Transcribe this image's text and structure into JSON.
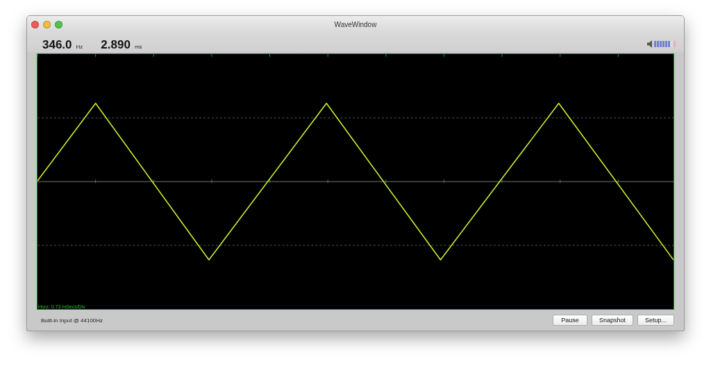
{
  "window": {
    "title": "WaveWindow"
  },
  "readouts": [
    {
      "value": "346.0",
      "unit": "Hz"
    },
    {
      "value": "2.890",
      "unit": "ms"
    }
  ],
  "volume": {
    "level": 0.75
  },
  "scope": {
    "scale_label": "Horz: 0.73 mSecs/Div"
  },
  "status": "Built-in Input @ 44100Hz",
  "buttons": [
    "Pause",
    "Snapshot",
    "Setup..."
  ]
}
